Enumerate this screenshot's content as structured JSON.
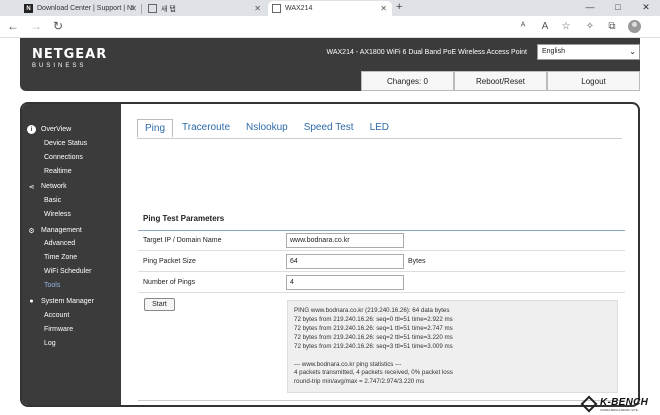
{
  "browser": {
    "tabs": [
      {
        "title": "Download Center | Support | NI"
      },
      {
        "title": "새 탭"
      },
      {
        "title": "WAX214"
      }
    ],
    "url": "",
    "window_buttons": [
      "—",
      "□",
      "✕"
    ]
  },
  "header": {
    "logo_main": "NETGEAR",
    "logo_sub": "BUSINESS",
    "model": "WAX214 - AX1800 WiFi 6 Dual Band PoE Wireless Access Point",
    "language": "English",
    "changes_label": "Changes: 0",
    "reboot_label": "Reboot/Reset",
    "logout_label": "Logout"
  },
  "sidebar": {
    "groups": [
      {
        "label": "OverView",
        "items": [
          "Device Status",
          "Connections",
          "Realtime"
        ]
      },
      {
        "label": "Network",
        "items": [
          "Basic",
          "Wireless"
        ]
      },
      {
        "label": "Management",
        "items": [
          "Advanced",
          "Time Zone",
          "WiFi Scheduler",
          "Tools"
        ]
      },
      {
        "label": "System Manager",
        "items": [
          "Account",
          "Firmware",
          "Log"
        ]
      }
    ],
    "active_item": "Tools"
  },
  "tools": {
    "tabs": [
      "Ping",
      "Traceroute",
      "Nslookup",
      "Speed Test",
      "LED"
    ],
    "active_tab": "Ping",
    "section_title": "Ping Test Parameters",
    "fields": [
      {
        "label": "Target IP / Domain Name",
        "value": "www.bodnara.co.kr",
        "unit": ""
      },
      {
        "label": "Ping Packet Size",
        "value": "64",
        "unit": "Bytes"
      },
      {
        "label": "Number of Pings",
        "value": "4",
        "unit": ""
      }
    ],
    "start_label": "Start",
    "output": [
      "PING www.bodnara.co.kr (219.240.16.26): 64 data bytes",
      "72 bytes from 219.240.16.26: seq=0 ttl=51 time=2.922 ms",
      "72 bytes from 219.240.16.26: seq=1 ttl=51 time=2.747 ms",
      "72 bytes from 219.240.16.26: seq=2 ttl=51 time=3.220 ms",
      "72 bytes from 219.240.16.26: seq=3 ttl=51 time=3.009 ms",
      "",
      "--- www.bodnara.co.kr ping statistics ---",
      "4 packets transmitted, 4 packets received, 0% packet loss",
      "round-trip min/avg/max = 2.747/2.974/3.220 ms"
    ]
  },
  "watermark": {
    "text": "K-BENCH",
    "sub": "KOREA BENCHMARK SITE"
  }
}
